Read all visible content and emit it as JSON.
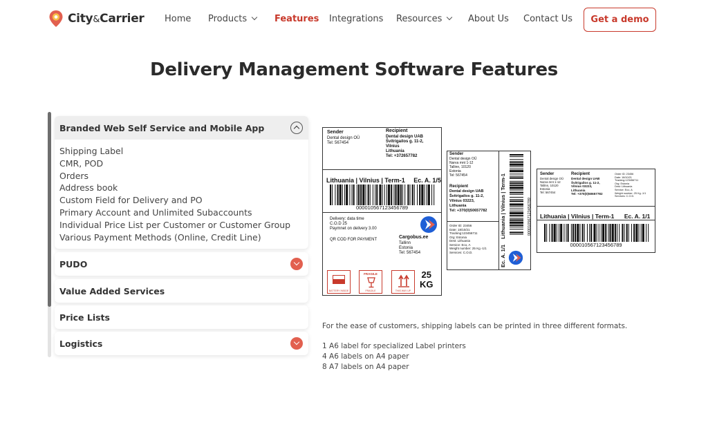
{
  "brand": {
    "name_part1": "City",
    "name_amp": "&",
    "name_part2": "Carrier",
    "accent": "#c8392b"
  },
  "nav": [
    {
      "label": "Home",
      "has_dropdown": false,
      "active": false
    },
    {
      "label": "Products",
      "has_dropdown": true,
      "active": false
    },
    {
      "label": "Features",
      "has_dropdown": false,
      "active": true
    },
    {
      "label": "Integrations",
      "has_dropdown": false,
      "active": false
    },
    {
      "label": "Resources",
      "has_dropdown": true,
      "active": false
    },
    {
      "label": "About Us",
      "has_dropdown": false,
      "active": false
    },
    {
      "label": "Contact Us",
      "has_dropdown": false,
      "active": false
    }
  ],
  "cta": {
    "label": "Get a demo"
  },
  "page": {
    "title": "Delivery Management Software Features"
  },
  "accordion": [
    {
      "title": "Branded  Web Self Service and Mobile App",
      "open": true,
      "items": [
        "Shipping Label",
        "CMR, POD",
        "Orders",
        "Address book",
        "Custom Field for Delivery and PO",
        "Primary Account and Unlimited Subaccounts",
        "Individual Price List per Customer or Customer Group",
        "Various Payment Methods (Online, Credit Line)"
      ]
    },
    {
      "title": "PUDO",
      "open": false,
      "toggle": "chevron-down"
    },
    {
      "title": "Value Added Services",
      "open": false,
      "toggle": "none"
    },
    {
      "title": "Price Lists",
      "open": false,
      "toggle": "none"
    },
    {
      "title": "Logistics",
      "open": false,
      "toggle": "chevron-down"
    }
  ],
  "labels": {
    "large": {
      "sender_heading": "Sender",
      "sender_lines": [
        "Dental design OÜ",
        "Tel: 567454"
      ],
      "recipient_heading": "Recipient",
      "recipient_lines": [
        "Dental design UAB",
        "Švitrigailos g. 11-2,",
        "Vilnius",
        "Lithuania",
        "Tel: +372657782"
      ],
      "route": "Lithuania | Vilnius | Term-1",
      "ec": "Ec. A. 1/5",
      "barcode_number": "000010567123456789",
      "details": [
        "Delivery: data time",
        "C.O.D  25",
        "Paymnet on delivery  3.00"
      ],
      "qr_text": "QR COD FOR PAYMENT",
      "carrier_name": "Cargobus.ee",
      "carrier_lines": [
        "Tallinn",
        "Estonia",
        "Tel: 567454"
      ],
      "icon_captions": [
        "BATTERY INSIDE",
        "FRAGILE",
        "THIS WAY UP"
      ],
      "fragile_word": "FRAGILE",
      "weight_value": "25",
      "weight_unit": "KG"
    },
    "medium": {
      "sender_heading": "Sender",
      "sender_lines": [
        "Dental design OÜ",
        "Narva mnt 1-12",
        "Tallinn, 10120",
        "Estonia",
        "Tel: 567454"
      ],
      "recipient_heading": "Recipient",
      "recipient_lines": [
        "Dental design UAB",
        "Švitrigailos g. 11-2,",
        "Vilnius 03223,",
        "Lithuania",
        "Tel: +370(0)50657782"
      ],
      "order_lines": [
        "Order ID: 23456",
        "Date: 18/10/21",
        "Tracking:123456711",
        "Org: Estonia",
        "Dest: Lithuania",
        "Service: Eco, A",
        "Weight number: 25 Kg -1/1",
        "Services: C.O.D."
      ],
      "route": "Lithuania | Vilnius | Term-1",
      "ec": "Ec. A. 1/1",
      "barcode_number": "000010567123456789"
    },
    "small": {
      "sender_heading": "Sender",
      "sender_lines": [
        "Dental design OÜ",
        "Narva mnt 1-12",
        "Tallinn, 10120",
        "Estonia",
        "Tel: 567454"
      ],
      "recipient_heading": "Recipient",
      "recipient_lines": [
        "Dental design UAB",
        "Švitrigailos g. 11-2,",
        "Vilnius 03223,",
        "Lithuania",
        "Tel: +370(0)50657782"
      ],
      "order_lines": [
        "Order ID: 23456",
        "Date: 18/10/21",
        "Tracking:123456711",
        "Org: Estonia",
        "Dest: Lithuania",
        "Service: Eco, A",
        "Weight number: 25 Kg -1/1",
        "Services: C.O.D."
      ],
      "route": "Lithuania | Vilnius | Term-1",
      "ec": "Ec. A. 1/1",
      "barcode_number": "000010567123456789"
    }
  },
  "description": "For the ease of customers, shipping labels can be printed in three different formats.",
  "formats": [
    "1 A6 label for specialized Label printers",
    "4 A6 labels on A4 paper",
    "8 A7 labels on A4 paper"
  ]
}
